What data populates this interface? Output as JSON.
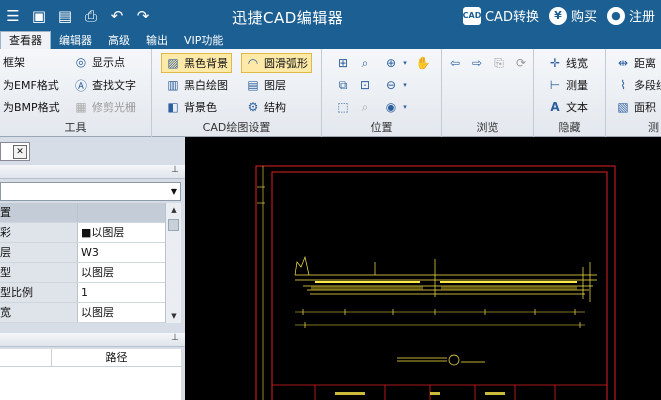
{
  "app": {
    "title": "迅捷CAD编辑器"
  },
  "title_right": {
    "convert_label": "CAD转换",
    "buy_label": "购买",
    "register_label": "注册",
    "convert_icon_text": "CAD",
    "buy_icon_text": "¥"
  },
  "tabs": [
    "查看器",
    "编辑器",
    "高级",
    "输出",
    "VIP功能"
  ],
  "ribbon": {
    "tools": {
      "label": "工具",
      "frame": "框架",
      "emf": "为EMF格式",
      "bmp": "为BMP格式",
      "show_points": "显示点",
      "find_text": "查找文字",
      "trim_raster": "修剪光栅"
    },
    "cad_settings": {
      "label": "CAD绘图设置",
      "black_bg": "黑色背景",
      "smooth_arc": "圆滑弧形",
      "bw_draw": "黑白绘图",
      "layers": "图层",
      "bg_color": "背景色",
      "structure": "结构"
    },
    "position": {
      "label": "位置"
    },
    "browse": {
      "label": "浏览"
    },
    "hide": {
      "label": "隐藏",
      "linewidth": "线宽",
      "measure": "测量",
      "text": "文本"
    },
    "measure": {
      "label": "测",
      "distance": "距离",
      "polyline": "多段线",
      "area": "面积"
    }
  },
  "properties": {
    "rows": [
      {
        "name": "置",
        "value": ""
      },
      {
        "name": "彩",
        "value": "以图层",
        "swatch": "■"
      },
      {
        "name": "层",
        "value": "W3"
      },
      {
        "name": "型",
        "value": "以图层"
      },
      {
        "name": "型比例",
        "value": "1"
      },
      {
        "name": "宽",
        "value": "以图层"
      }
    ]
  },
  "list": {
    "path_header": "路径"
  },
  "colors": {
    "titlebar": "#1c5f93",
    "cad_yellow": "#ffe94a",
    "cad_red": "#e02020"
  }
}
